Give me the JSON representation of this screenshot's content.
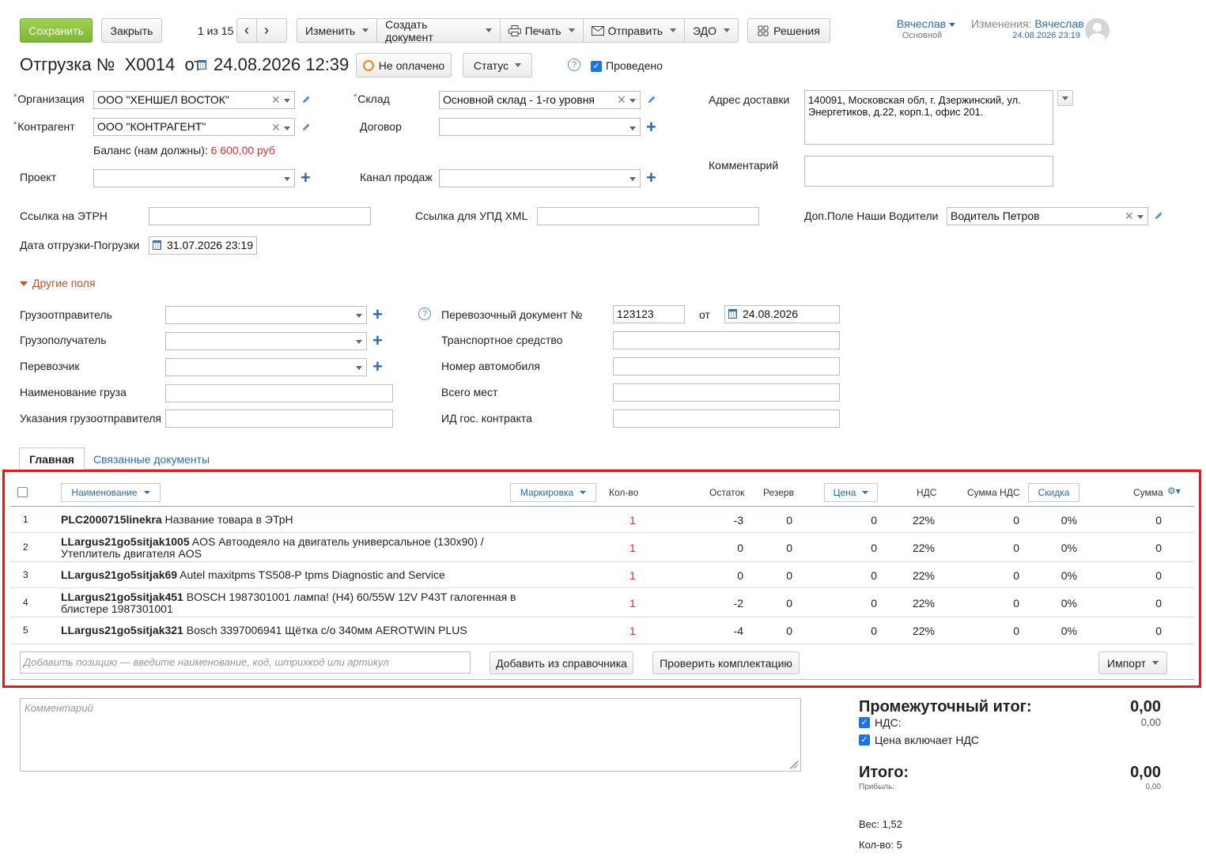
{
  "toolbar": {
    "save": "Сохранить",
    "close": "Закрыть",
    "pager": "1 из 15",
    "edit": "Изменить",
    "create_doc": "Создать документ",
    "print": "Печать",
    "send": "Отправить",
    "edo": "ЭДО",
    "solutions": "Решения"
  },
  "user": {
    "name": "Вячеслав",
    "role": "Основной",
    "changes_label": "Изменения:",
    "changes_user": "Вячеслав",
    "changes_date": "24.08.2026 23:19"
  },
  "doc": {
    "title_prefix": "Отгрузка №",
    "number": "X0014",
    "from": "от",
    "datetime": "24.08.2026 12:39",
    "payment_status": "Не оплачено",
    "status_btn": "Статус",
    "posted_label": "Проведено"
  },
  "fields": {
    "org_label": "Организация",
    "org_value": "ООО \"ХЕНШЕЛ ВОСТОК\"",
    "counterparty_label": "Контрагент",
    "counterparty_value": "ООО \"КОНТРАГЕНТ\"",
    "balance_label": "Баланс (нам должны):",
    "balance_value": "6 600,00 руб",
    "project_label": "Проект",
    "warehouse_label": "Склад",
    "warehouse_value": "Основной склад - 1-го уровня",
    "contract_label": "Договор",
    "sales_channel_label": "Канал продаж",
    "delivery_address_label": "Адрес доставки",
    "delivery_address_value": "140091, Московская обл, г. Дзержинский,  ул. Энергетиков, д.22, корп.1, офис 201.",
    "comment_label": "Комментарий",
    "etrn_label": "Ссылка на ЭТРН",
    "upd_label": "Ссылка для УПД XML",
    "drivers_label": "Доп.Поле Наши Водители",
    "drivers_value": "Водитель Петров",
    "ship_date_label": "Дата отгрузки-Погрузки",
    "ship_date_value": "31.07.2026 23:19"
  },
  "other_fields": {
    "toggle": "Другие поля",
    "shipper_label": "Грузоотправитель",
    "consignee_label": "Грузополучатель",
    "carrier_label": "Перевозчик",
    "cargo_name_label": "Наименование груза",
    "shipper_instructions_label": "Указания грузоотправителя",
    "transport_doc_label": "Перевозочный документ №",
    "transport_doc_value": "123123",
    "transport_doc_from": "от",
    "transport_doc_date": "24.08.2026",
    "vehicle_label": "Транспортное средство",
    "plate_label": "Номер автомобиля",
    "places_label": "Всего мест",
    "contract_id_label": "ИД гос. контракта"
  },
  "tabs": {
    "main": "Главная",
    "related": "Связанные документы"
  },
  "table": {
    "headers": {
      "name": "Наименование",
      "marking": "Маркировка",
      "qty": "Кол-во",
      "stock": "Остаток",
      "reserve": "Резерв",
      "price": "Цена",
      "vat": "НДС",
      "vat_sum": "Сумма НДС",
      "discount": "Скидка",
      "sum": "Сумма"
    },
    "rows": [
      {
        "n": "1",
        "code": "PLC2000715linekra",
        "name": " Название товара в ЭТрН",
        "name2": "",
        "qty": "1",
        "stock": "-3",
        "reserve": "0",
        "price": "0",
        "vat": "22%",
        "vat_sum": "0",
        "discount": "0%",
        "sum": "0"
      },
      {
        "n": "2",
        "code": "LLargus21go5sitjak1005",
        "name": " AOS Автоодеяло на двигатель универсальное (130x90) /",
        "name2": "Утеплитель двигателя AOS",
        "qty": "1",
        "stock": "0",
        "reserve": "0",
        "price": "0",
        "vat": "22%",
        "vat_sum": "0",
        "discount": "0%",
        "sum": "0"
      },
      {
        "n": "3",
        "code": "LLargus21go5sitjak69",
        "name": " Autel maxitpms TS508-P tpms Diagnostic and Service",
        "name2": "",
        "qty": "1",
        "stock": "0",
        "reserve": "0",
        "price": "0",
        "vat": "22%",
        "vat_sum": "0",
        "discount": "0%",
        "sum": "0"
      },
      {
        "n": "4",
        "code": "LLargus21go5sitjak451",
        "name": " BOSCH 1987301001 лампа! (H4) 60/55W 12V P43T галогенная в",
        "name2": "блистере 1987301001",
        "qty": "1",
        "stock": "-2",
        "reserve": "0",
        "price": "0",
        "vat": "22%",
        "vat_sum": "0",
        "discount": "0%",
        "sum": "0"
      },
      {
        "n": "5",
        "code": "LLargus21go5sitjak321",
        "name": " Bosch 3397006941 Щётка с/о 340мм AEROTWIN PLUS",
        "name2": "",
        "qty": "1",
        "stock": "-4",
        "reserve": "0",
        "price": "0",
        "vat": "22%",
        "vat_sum": "0",
        "discount": "0%",
        "sum": "0"
      }
    ],
    "add_placeholder": "Добавить позицию — введите наименование, код, штрихкод или артикул",
    "add_from_catalog": "Добавить из справочника",
    "check_kit": "Проверить комплектацию",
    "import": "Импорт"
  },
  "footer": {
    "comment_placeholder": "Комментарий",
    "subtotal_label": "Промежуточный итог:",
    "subtotal_value": "0,00",
    "vat_label": "НДС:",
    "vat_value": "0,00",
    "price_incl_vat_label": "Цена включает НДС",
    "total_label": "Итого:",
    "total_value": "0,00",
    "profit_label": "Прибыль:",
    "profit_value": "0,00",
    "weight": "Вес: 1,52",
    "count": "Кол-во: 5"
  },
  "colors": {
    "save_green": "#8cc63f",
    "highlight_red": "#e0191f",
    "link_blue": "#2b6cb0",
    "qty_red": "#d9342b",
    "checkbox_blue": "#1a73e8"
  }
}
